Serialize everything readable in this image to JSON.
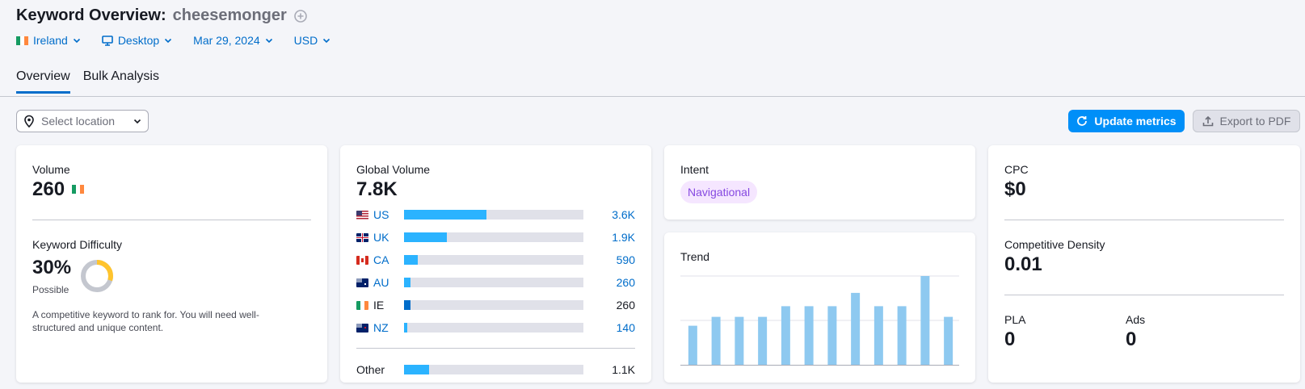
{
  "header": {
    "title": "Keyword Overview:",
    "keyword": "cheesemonger"
  },
  "filters": {
    "country": "Ireland",
    "device": "Desktop",
    "date": "Mar 29, 2024",
    "currency": "USD"
  },
  "tabs": [
    {
      "label": "Overview",
      "active": true
    },
    {
      "label": "Bulk Analysis",
      "active": false
    }
  ],
  "toolbar": {
    "location_placeholder": "Select location",
    "update_label": "Update metrics",
    "export_label": "Export to PDF"
  },
  "volume": {
    "label": "Volume",
    "value": "260"
  },
  "keyword_difficulty": {
    "label": "Keyword Difficulty",
    "value": "30%",
    "level": "Possible",
    "percent": 30,
    "description": "A competitive keyword to rank for. You will need well-structured and unique content."
  },
  "global_volume": {
    "label": "Global Volume",
    "value": "7.8K",
    "rows": [
      {
        "code": "US",
        "value": "3.6K",
        "share": 0.46,
        "link": true
      },
      {
        "code": "UK",
        "value": "1.9K",
        "share": 0.24,
        "link": true
      },
      {
        "code": "CA",
        "value": "590",
        "share": 0.076,
        "link": true
      },
      {
        "code": "AU",
        "value": "260",
        "share": 0.034,
        "link": true
      },
      {
        "code": "IE",
        "value": "260",
        "share": 0.034,
        "link": false
      },
      {
        "code": "NZ",
        "value": "140",
        "share": 0.018,
        "link": true
      }
    ],
    "other": {
      "label": "Other",
      "value": "1.1K",
      "share": 0.14
    }
  },
  "intent": {
    "label": "Intent",
    "badge": "Navigational"
  },
  "trend": {
    "label": "Trend",
    "values": [
      0.44,
      0.54,
      0.54,
      0.54,
      0.66,
      0.66,
      0.66,
      0.81,
      0.66,
      0.66,
      1.0,
      0.54
    ]
  },
  "cpc": {
    "label": "CPC",
    "value": "$0"
  },
  "competitive_density": {
    "label": "Competitive Density",
    "value": "0.01"
  },
  "pla": {
    "label": "PLA",
    "value": "0"
  },
  "ads": {
    "label": "Ads",
    "value": "0"
  },
  "colors": {
    "accent": "#008ff8",
    "link": "#006dca",
    "bar_primary": "#2bb3ff",
    "bar_dark": "#006dca",
    "trend_bar": "#8ec9f0",
    "kd_yellow": "#ffc42d",
    "kd_gray": "#c4c7cf"
  }
}
